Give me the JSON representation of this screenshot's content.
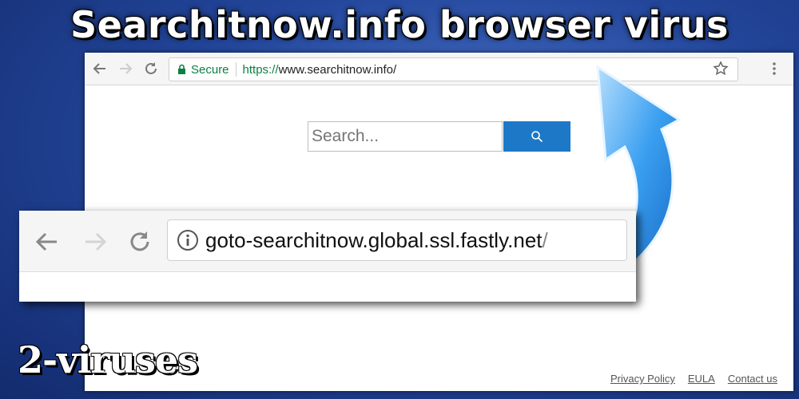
{
  "headline": "Searchitnow.info browser virus",
  "browser": {
    "secure_label": "Secure",
    "url_scheme": "https://",
    "url_rest": "www.searchitnow.info/",
    "icons": [
      "back-arrow-icon",
      "forward-arrow-icon",
      "reload-icon",
      "lock-icon",
      "star-icon",
      "menu-dots-icon"
    ]
  },
  "page": {
    "search_placeholder": "Search...",
    "search_button_icon": "magnifier-icon",
    "search_button_color": "#1d78c8",
    "footer_links": [
      "Privacy Policy",
      "EULA",
      "Contact us"
    ]
  },
  "popout": {
    "url_main": "goto-searchitnow.global.ssl.fastly.net",
    "url_slash": "/",
    "icons": [
      "back-arrow-icon",
      "forward-arrow-icon",
      "reload-icon",
      "info-icon"
    ]
  },
  "brand": "2-viruses",
  "colors": {
    "background": "#23469b",
    "secure_green": "#0b8043",
    "arrow_blue": "#3a9ff0"
  }
}
